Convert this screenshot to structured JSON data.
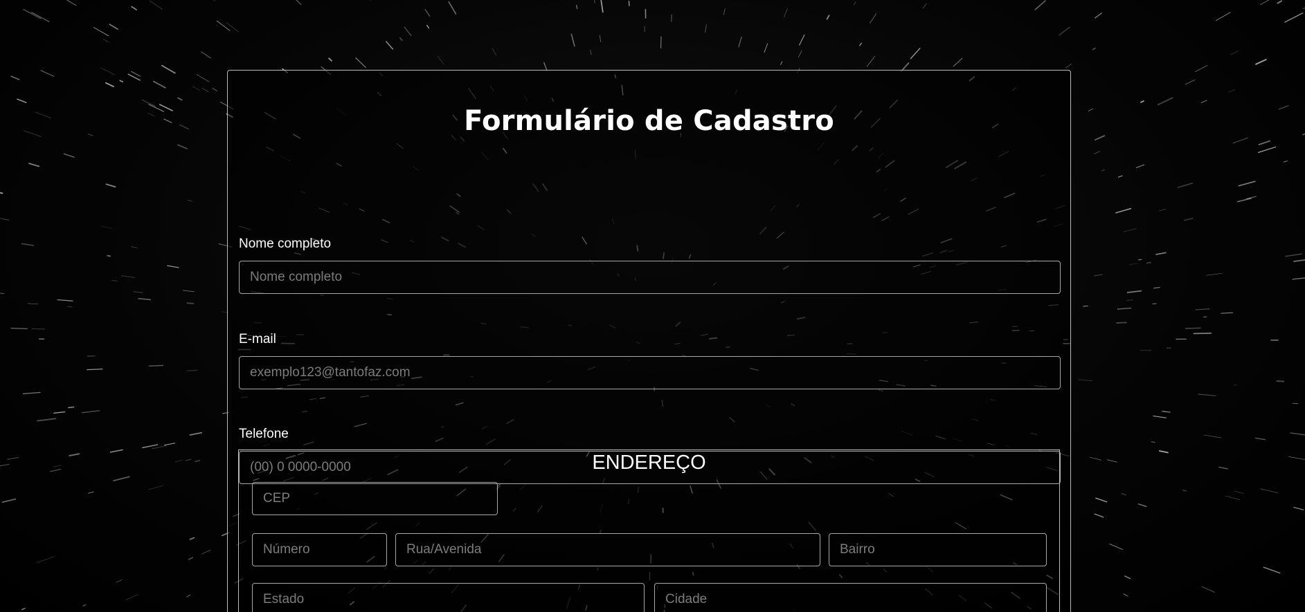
{
  "form": {
    "title": "Formulário de Cadastro",
    "name": {
      "label": "Nome completo",
      "placeholder": "Nome completo"
    },
    "email": {
      "label": "E-mail",
      "placeholder": "exemplo123@tantofaz.com"
    },
    "phone": {
      "label": "Telefone",
      "placeholder": "(00) 0 0000-0000"
    },
    "address": {
      "legend": "ENDEREÇO",
      "cep_placeholder": "CEP",
      "number_placeholder": "Número",
      "street_placeholder": "Rua/Avenida",
      "district_placeholder": "Bairro",
      "state_placeholder": "Estado",
      "city_placeholder": "Cidade"
    }
  },
  "colors": {
    "background": "#000000",
    "border": "#bdbdbd",
    "text": "#ffffff",
    "placeholder": "#7c7c7c"
  }
}
